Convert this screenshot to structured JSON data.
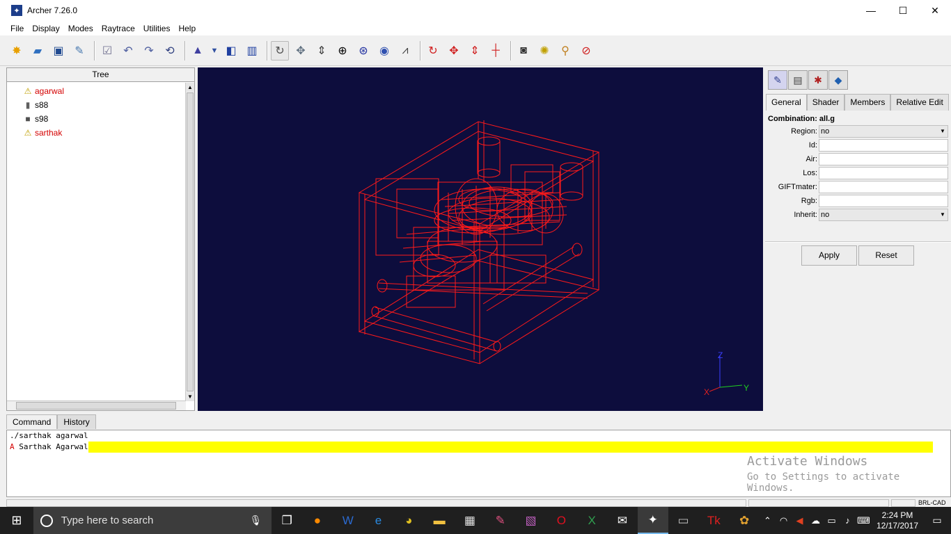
{
  "window": {
    "title": "Archer 7.26.0",
    "minimize": "—",
    "maximize": "☐",
    "close": "✕"
  },
  "menu": [
    "File",
    "Display",
    "Modes",
    "Raytrace",
    "Utilities",
    "Help"
  ],
  "toolbar_icons": [
    "new-file",
    "open-file",
    "save",
    "preferences",
    "check",
    "undo",
    "redo",
    "revert",
    "wizard",
    "dropdown",
    "raise-window",
    "wireframe",
    "rotate",
    "translate",
    "scale",
    "center",
    "zoom",
    "view-cube",
    "measure",
    "rotate-object",
    "move-object",
    "scale-object",
    "center-object",
    "raytrace-camera",
    "render",
    "clean",
    "abort"
  ],
  "tree": {
    "header": "Tree",
    "items": [
      {
        "label": "agarwal",
        "icon": "warning-icon",
        "color": "#d40000"
      },
      {
        "label": "s88",
        "icon": "cylinder-icon",
        "color": "#000000"
      },
      {
        "label": "s98",
        "icon": "box-icon",
        "color": "#000000"
      },
      {
        "label": "sarthak",
        "icon": "warning-icon",
        "color": "#d40000"
      }
    ]
  },
  "viewport": {
    "background": "#0d0d3d",
    "wire_color": "#ff1a1a",
    "axes": {
      "z": "Z",
      "y": "Y",
      "x": "X"
    }
  },
  "right_panel": {
    "tabs": [
      "General",
      "Shader",
      "Members",
      "Relative Edit"
    ],
    "active_tab": "General",
    "combination_label": "Combination: all.g",
    "fields": [
      {
        "label": "Region:",
        "value": "no",
        "type": "select"
      },
      {
        "label": "Id:",
        "value": "",
        "type": "text"
      },
      {
        "label": "Air:",
        "value": "",
        "type": "text"
      },
      {
        "label": "Los:",
        "value": "",
        "type": "text"
      },
      {
        "label": "GIFTmater:",
        "value": "",
        "type": "text"
      },
      {
        "label": "Rgb:",
        "value": "",
        "type": "text"
      },
      {
        "label": "Inherit:",
        "value": "no",
        "type": "select"
      }
    ],
    "apply": "Apply",
    "reset": "Reset"
  },
  "command": {
    "tabs": [
      "Command",
      "History"
    ],
    "lines": [
      {
        "mark": "",
        "text": "./sarthak agarwal",
        "highlight": false
      },
      {
        "mark": "A",
        "text": " Sarthak Agarwal",
        "highlight": true
      }
    ]
  },
  "activation": {
    "title": "Activate Windows",
    "subtitle": "Go to Settings to activate Windows."
  },
  "status": {
    "right_text": "BRL-CAD"
  },
  "taskbar": {
    "search_placeholder": "Type here to search",
    "apps": [
      "task-view",
      "firefox",
      "word",
      "edge",
      "chrome",
      "file-explorer",
      "store",
      "ppt-reader",
      "notes",
      "opera",
      "excel",
      "mail",
      "archer",
      "terminal",
      "tcl",
      "paint"
    ],
    "time": "2:24 PM",
    "date": "12/17/2017"
  }
}
